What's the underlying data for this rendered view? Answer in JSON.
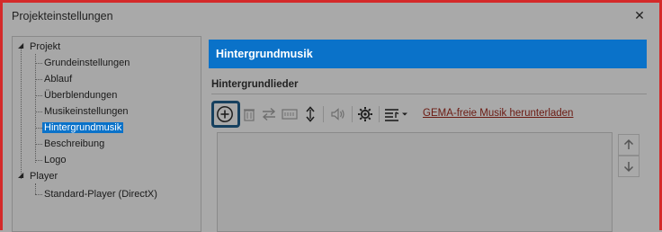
{
  "window": {
    "title": "Projekteinstellungen",
    "close_glyph": "✕"
  },
  "tree": {
    "root": "Projekt",
    "children": [
      "Grundeinstellungen",
      "Ablauf",
      "Überblendungen",
      "Musikeinstellungen",
      "Hintergrundmusik",
      "Beschreibung",
      "Logo"
    ],
    "selected": "Hintergrundmusik",
    "player": "Player",
    "player_children": [
      "Standard-Player (DirectX)"
    ]
  },
  "panel": {
    "header": "Hintergrundmusik",
    "section_title": "Hintergrundlieder",
    "toolbar": {
      "icons": [
        "add-icon",
        "delete-icon",
        "swap-icon",
        "time-icon",
        "resize-icon",
        "volume-icon",
        "settings-icon",
        "list-icon",
        "dropdown-icon"
      ],
      "link": "GEMA-freie Musik herunterladen"
    },
    "colors": {
      "accent": "#0a72c9",
      "highlight_border": "#16405f",
      "link": "#6b1a12",
      "frame": "#d42a2a"
    }
  }
}
